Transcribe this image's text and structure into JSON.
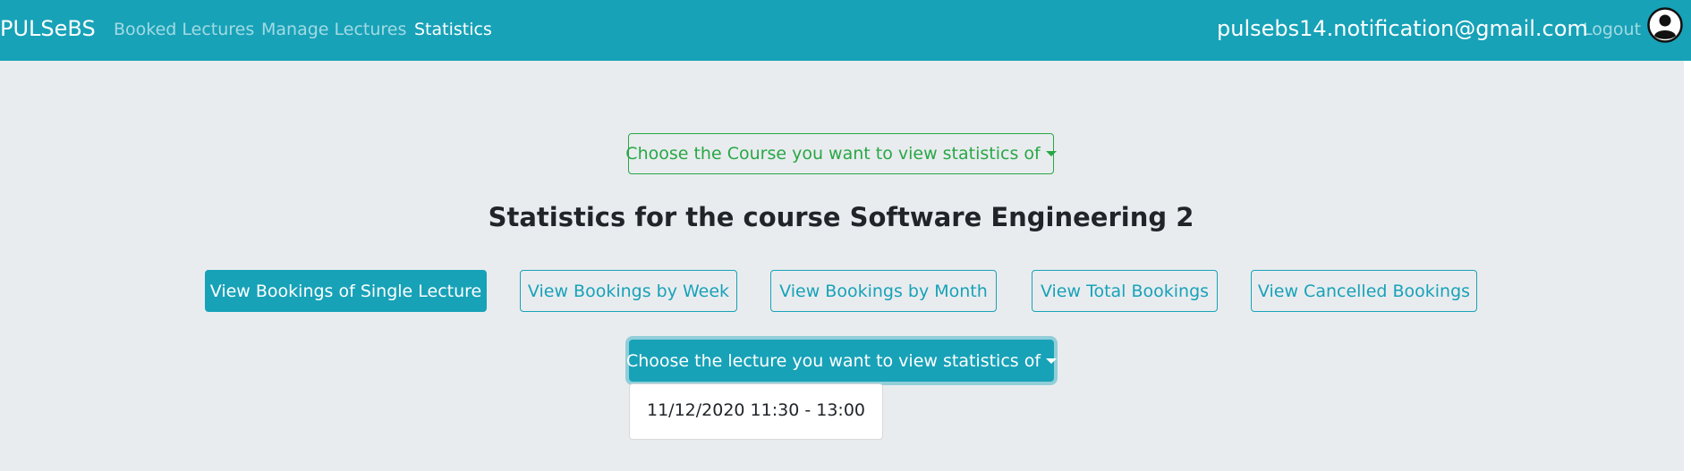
{
  "navbar": {
    "brand": "PULSeBS",
    "links": [
      {
        "label": "Booked Lectures",
        "active": false
      },
      {
        "label": "Manage Lectures",
        "active": false
      },
      {
        "label": "Statistics",
        "active": true
      }
    ],
    "user_email": "pulsebs14.notification@gmail.com",
    "logout_label": "Logout",
    "avatar_icon": "user-circle-icon"
  },
  "course_dropdown": {
    "label": "Choose the Course you want to view statistics of"
  },
  "heading": "Statistics for the course Software Engineering 2",
  "view_buttons": [
    {
      "label": "View Bookings of Single Lecture",
      "active": true
    },
    {
      "label": "View Bookings by Week",
      "active": false
    },
    {
      "label": "View Bookings by Month",
      "active": false
    },
    {
      "label": "View Total Bookings",
      "active": false
    },
    {
      "label": "View Cancelled Bookings",
      "active": false
    }
  ],
  "lecture_dropdown": {
    "label": "Choose the lecture you want to view statistics of",
    "options": [
      "11/12/2020 11:30 - 13:00"
    ]
  },
  "colors": {
    "primary": "#17a2b8",
    "success": "#28a745",
    "background": "#e9ecef"
  }
}
